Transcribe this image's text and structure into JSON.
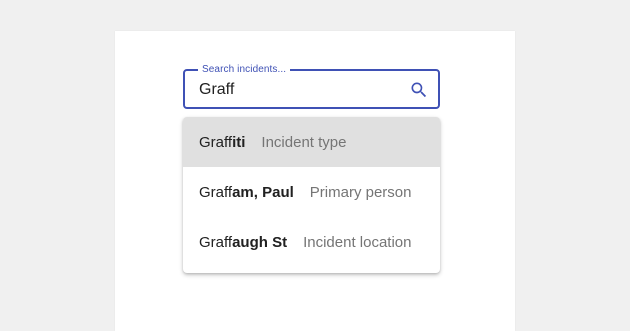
{
  "search": {
    "label": "Search incidents...",
    "value": "Graff",
    "icon": "search-icon"
  },
  "accent_color": "#3f51b5",
  "suggestions": [
    {
      "match": "Graff",
      "rest": "iti",
      "type": "Incident type",
      "highlighted": true
    },
    {
      "match": "Graff",
      "rest": "am, Paul",
      "type": "Primary person",
      "highlighted": false
    },
    {
      "match": "Graff",
      "rest": "augh St",
      "type": "Incident location",
      "highlighted": false
    }
  ]
}
